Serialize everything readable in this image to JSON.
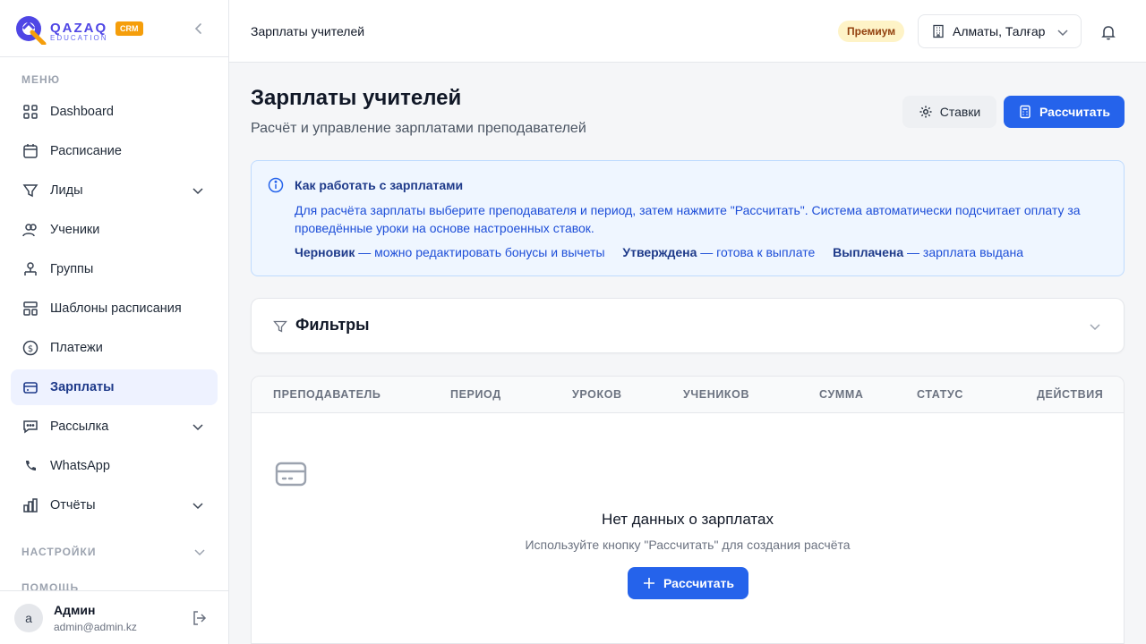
{
  "brand": {
    "name": "QAZAQ",
    "sub": "EDUCATION",
    "badge": "CRM"
  },
  "sidebar": {
    "menu_label": "МЕНЮ",
    "items": [
      {
        "label": "Dashboard",
        "icon": "dashboard-icon"
      },
      {
        "label": "Расписание",
        "icon": "calendar-icon"
      },
      {
        "label": "Лиды",
        "icon": "funnel-icon"
      },
      {
        "label": "Ученики",
        "icon": "users-icon"
      },
      {
        "label": "Группы",
        "icon": "groups-icon"
      },
      {
        "label": "Шаблоны расписания",
        "icon": "template-icon"
      },
      {
        "label": "Платежи",
        "icon": "dollar-icon"
      },
      {
        "label": "Зарплаты",
        "icon": "card-icon",
        "active": true
      },
      {
        "label": "Рассылка",
        "icon": "message-icon"
      },
      {
        "label": "WhatsApp",
        "icon": "phone-icon"
      },
      {
        "label": "Отчёты",
        "icon": "chart-icon"
      }
    ],
    "settings_label": "НАСТРОЙКИ",
    "help_label": "ПОМОЩЬ"
  },
  "user": {
    "initial": "a",
    "name": "Админ",
    "email": "admin@admin.kz"
  },
  "header": {
    "title": "Зарплаты учителей",
    "plan": "Премиум",
    "branch": "Алматы, Талғар"
  },
  "page": {
    "title": "Зарплаты учителей",
    "subtitle": "Расчёт и управление зарплатами преподавателей",
    "rates_button": "Ставки",
    "calc_button": "Рассчитать"
  },
  "info": {
    "title": "Как работать с зарплатами",
    "text": "Для расчёта зарплаты выберите преподавателя и период, затем нажмите \"Рассчитать\". Система автоматически подсчитает оплату за проведённые уроки на основе настроенных ставок.",
    "statuses": [
      {
        "name": "Черновик",
        "desc": "— можно редактировать бонусы и вычеты"
      },
      {
        "name": "Утверждена",
        "desc": "— готова к выплате"
      },
      {
        "name": "Выплачена",
        "desc": "— зарплата выдана"
      }
    ]
  },
  "filters": {
    "title": "Фильтры"
  },
  "table": {
    "columns": [
      "ПРЕПОДАВАТЕЛЬ",
      "ПЕРИОД",
      "УРОКОВ",
      "УЧЕНИКОВ",
      "СУММА",
      "СТАТУС",
      "ДЕЙСТВИЯ"
    ],
    "empty_title": "Нет данных о зарплатах",
    "empty_sub": "Используйте кнопку \"Рассчитать\" для создания расчёта",
    "empty_button": "Рассчитать"
  },
  "colors": {
    "primary": "#2563eb",
    "active_bg": "#eef2ff",
    "info_bg": "#eff6ff",
    "premium_bg": "#fef3c7"
  }
}
